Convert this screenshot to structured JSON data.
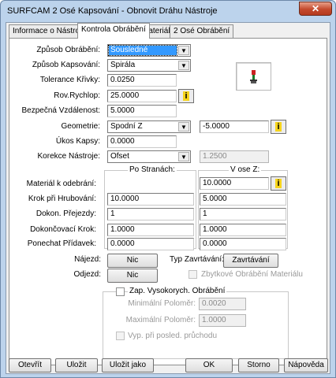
{
  "window": {
    "title": "SURFCAM 2 Osé Kapsování - Obnovit Dráhu Nástroje",
    "close_glyph": "✕"
  },
  "tabs": [
    {
      "label": "Informace o Nástroji",
      "active": false
    },
    {
      "label": "Kontrola Obrábění",
      "active": true
    },
    {
      "label": "Materiál",
      "active": false
    },
    {
      "label": "2 Osé Obrábění",
      "active": false
    }
  ],
  "icons": {
    "info_button": "lightbulb-info-icon",
    "preview": "tool-preview-icon",
    "dropdown": "dropdown-arrow-icon"
  },
  "form": {
    "zpusob_obrabeni": {
      "label": "Způsob Obrábění:",
      "value": "Sousledné"
    },
    "zpusob_kapsovani": {
      "label": "Způsob Kapsování:",
      "value": "Spirála"
    },
    "tolerance_krivky": {
      "label": "Tolerance Křivky:",
      "value": "0.0250"
    },
    "rov_rychlop": {
      "label": "Rov.Rychlop:",
      "value": "25.0000",
      "button": "i"
    },
    "bezpecna_vzdalenost": {
      "label": "Bezpečná Vzdálenost:",
      "value": "5.0000"
    },
    "geometrie": {
      "label": "Geometrie:",
      "value": "Spodní Z",
      "z_value": "-5.0000",
      "button": "i"
    },
    "ukos_kapsy": {
      "label": "Úkos Kapsy:",
      "value": "0.0000"
    },
    "korekce_nastroje": {
      "label": "Korekce Nástroje:",
      "value": "Ofset",
      "offset_value": "1.2500"
    }
  },
  "columns": {
    "po_stranach": "Po Stranách:",
    "v_ose_z": "V ose Z:"
  },
  "stock_rows": [
    {
      "label": "Materiál k odebrání:",
      "side": "",
      "z": "10.0000",
      "z_button": "i"
    },
    {
      "label": "Krok při Hrubování:",
      "side": "10.0000",
      "z": "5.0000"
    },
    {
      "label": "Dokon. Přejezdy:",
      "side": "1",
      "z": "1"
    },
    {
      "label": "Dokončovací Krok:",
      "side": "1.0000",
      "z": "1.0000"
    },
    {
      "label": "Ponechat Přídavek:",
      "side": "0.0000",
      "z": "0.0000"
    }
  ],
  "najezd": {
    "label": "Nájezd:",
    "button": "Nic"
  },
  "odjezd": {
    "label": "Odjezd:",
    "button": "Nic"
  },
  "typ_zavrtavani": {
    "label": "Typ Zavrtávání:",
    "button": "Zavrtávání"
  },
  "zbytkove_obrabeni": {
    "label": "Zbytkové Obrábění Materiálu",
    "checked": false
  },
  "vysokorych": {
    "label": "Zap. Vysokorych. Obrábění",
    "checked": false,
    "min_polomer": {
      "label": "Minimální Poloměr:",
      "value": "0.0020"
    },
    "max_polomer": {
      "label": "Maximální Poloměr:",
      "value": "1.0000"
    },
    "vyp_label": "Vyp. při posled. průchodu"
  },
  "footer": {
    "otevrit": "Otevřít",
    "ulozit": "Uložit",
    "ulozit_jako": "Uložit jako",
    "ok": "OK",
    "storno": "Storno",
    "napoveda": "Nápověda"
  },
  "colors": {
    "title_bar": "#bcd3ec",
    "selection": "#3399ff",
    "close_button": "#c44a2d"
  }
}
